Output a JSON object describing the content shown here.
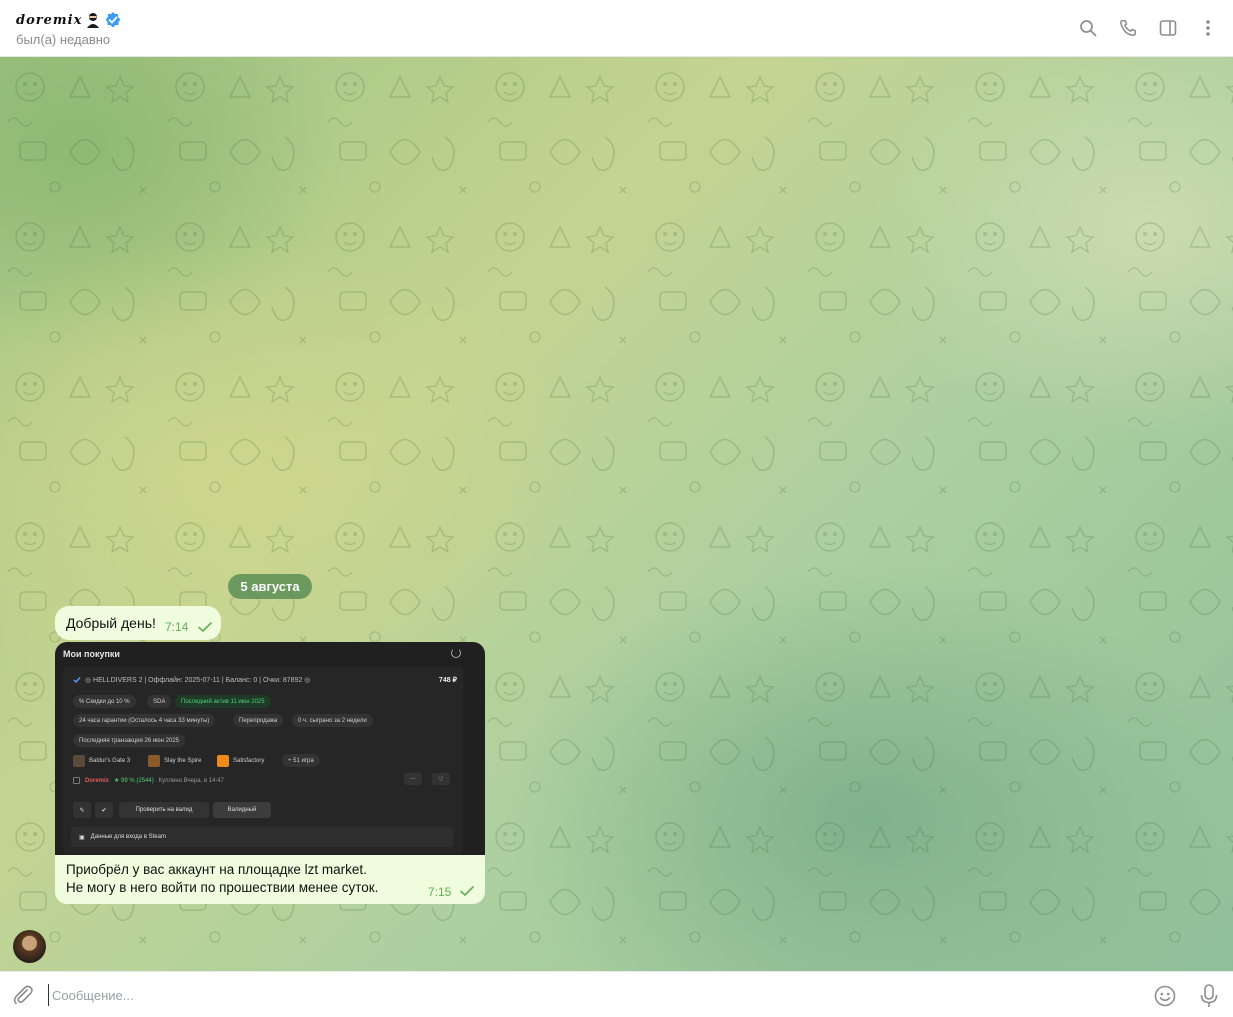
{
  "header": {
    "name": "doremix",
    "status": "был(а) недавно"
  },
  "chat": {
    "date_chip": "5 августа",
    "messages": [
      {
        "text": "Добрый день!",
        "time": "7:14"
      },
      {
        "caption_line1": "Приобрёл у вас аккаунт на площадке lzt market.",
        "caption_line2": "Не могу в него войти по прошествии менее суток.",
        "time": "7:15",
        "screenshot": {
          "title": "Мои покупки",
          "line1": "◎ HELLDIVERS 2 | Оффлайн: 2025-07-11 | Баланс: 0 | Очки: 87892 ◎",
          "price": "748 ₽",
          "pills_row1": [
            "% Скидки до 10 %",
            "SDA",
            "Последний актив 11 июн 2025"
          ],
          "pills_row2": [
            "24 часа гарантии (Осталось 4 часа 33 минуты)",
            "Перепродажа",
            "0 ч. сыграно за 2 недели"
          ],
          "pills_row3": [
            "Последняя транзакция 26 июн 2025"
          ],
          "games": [
            "Baldur's Gate 3",
            "Slay the Spire",
            "Satisfactory",
            "+ 51 игра"
          ],
          "seller": "Doremix",
          "seller_rating": "★ 99 % (2544)",
          "seller_time": "Куплено Вчера, в 14:47",
          "check_button": "Проверить на валид",
          "valid_button": "Валидный",
          "steam_row": "Данные для входа в Steam"
        }
      }
    ]
  },
  "composer": {
    "placeholder": "Сообщение..."
  },
  "colors": {
    "bubble": "#effdde",
    "accent": "#5fae53",
    "verified": "#3b9df0"
  }
}
